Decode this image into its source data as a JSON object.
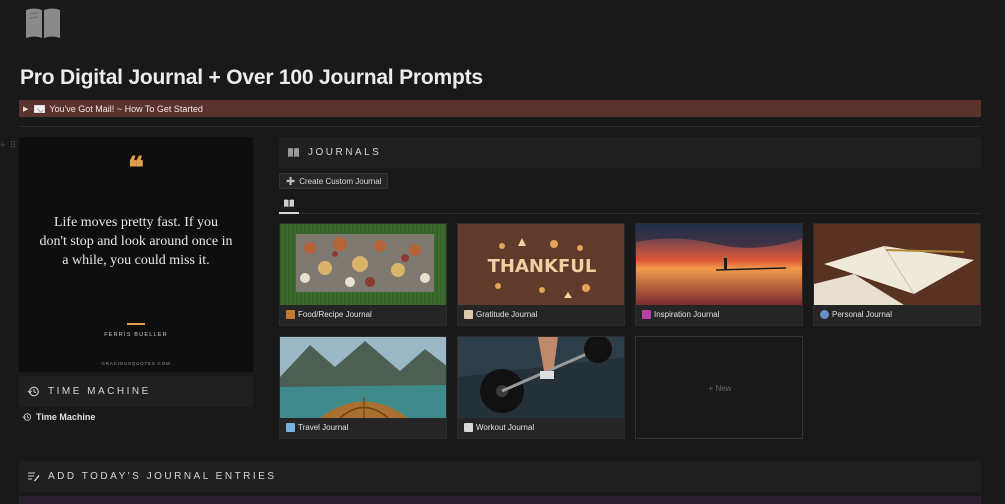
{
  "page": {
    "title": "Pro Digital Journal + Over 100 Journal Prompts",
    "icon": "book-icon"
  },
  "toggle": {
    "label": "You've Got Mail! ~ How To Get Started",
    "icon": "mail-icon",
    "color": "#5a3330"
  },
  "quote": {
    "mark": "❝",
    "text": "Life moves pretty fast. If you don't stop and look around once in a while, you could miss it.",
    "author": "FERRIS BUELLER",
    "site": "GRACIOUSQUOTES.COM",
    "accent": "#e0a04a"
  },
  "time_machine": {
    "header": "TIME MACHINE",
    "item": "Time Machine"
  },
  "journals": {
    "header": "JOURNALS",
    "create_button": "Create Custom Journal",
    "new_label": "+ New",
    "cards": [
      {
        "label": "Food/Recipe Journal",
        "icon": "food-icon"
      },
      {
        "label": "Gratitude Journal",
        "icon": "meditation-icon"
      },
      {
        "label": "Inspiration Journal",
        "icon": "sparkle-icon"
      },
      {
        "label": "Personal Journal",
        "icon": "person-icon"
      },
      {
        "label": "Travel Journal",
        "icon": "airplane-icon"
      },
      {
        "label": "Workout Journal",
        "icon": "weightlifter-icon"
      }
    ],
    "gratitude_image_text": "THANKFUL"
  },
  "entries": {
    "header": "ADD TODAY'S JOURNAL ENTRIES"
  }
}
